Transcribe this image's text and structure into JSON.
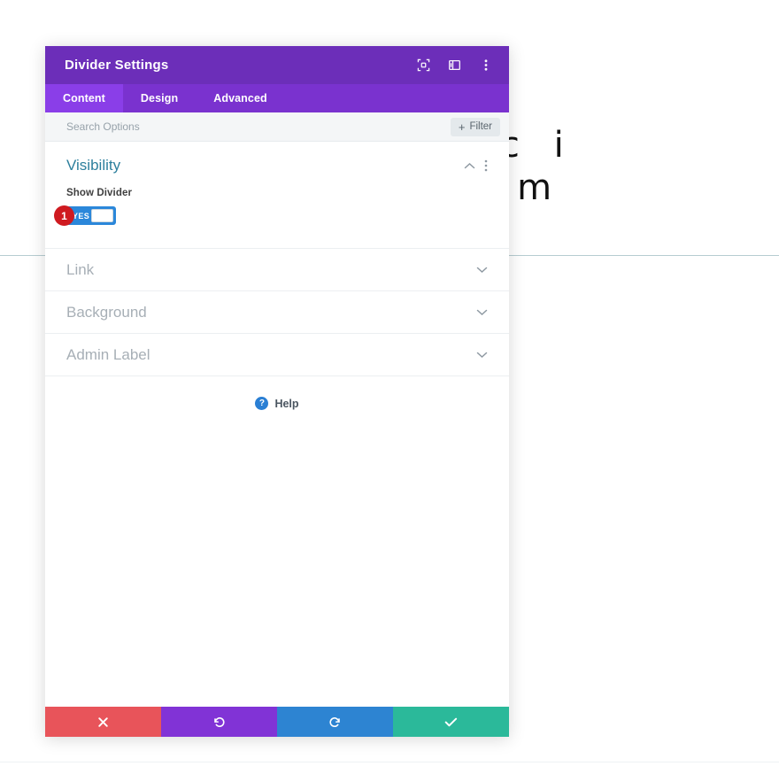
{
  "page_background": {
    "heading_line1": "d  E x e r c i",
    "heading_line2": "r i t a t e m",
    "divider_color": "#b6cdd1"
  },
  "modal": {
    "title": "Divider Settings",
    "header_color": "#6c2eb9",
    "header_icons": [
      {
        "name": "focus-icon",
        "label": "Focus"
      },
      {
        "name": "layout-panel-icon",
        "label": "Layout"
      },
      {
        "name": "more-vertical-icon",
        "label": "More"
      }
    ],
    "tabs": [
      {
        "label": "Content",
        "active": true
      },
      {
        "label": "Design",
        "active": false
      },
      {
        "label": "Advanced",
        "active": false
      }
    ],
    "search": {
      "placeholder": "Search Options",
      "value": ""
    },
    "filter_button": {
      "label": "Filter",
      "plus": "+"
    },
    "sections": {
      "open": {
        "title": "Visibility",
        "collapse_icon": "chevron-up-icon",
        "menu_icon": "more-vertical-icon",
        "fields": [
          {
            "label": "Show Divider",
            "type": "toggle",
            "value": "YES",
            "state": "on",
            "accent": "#2b87da",
            "step_badge": "1"
          }
        ]
      },
      "collapsed": [
        {
          "title": "Link",
          "icon": "chevron-down-icon"
        },
        {
          "title": "Background",
          "icon": "chevron-down-icon"
        },
        {
          "title": "Admin Label",
          "icon": "chevron-down-icon"
        }
      ]
    },
    "help": {
      "icon_glyph": "?",
      "label": "Help"
    },
    "footer_buttons": [
      {
        "name": "cancel-button",
        "icon": "close-icon",
        "color": "#e8545a"
      },
      {
        "name": "undo-button",
        "icon": "undo-icon",
        "color": "#8133d6"
      },
      {
        "name": "redo-button",
        "icon": "redo-icon",
        "color": "#2d84d2"
      },
      {
        "name": "save-button",
        "icon": "checkmark-icon",
        "color": "#2bb99a"
      }
    ]
  }
}
